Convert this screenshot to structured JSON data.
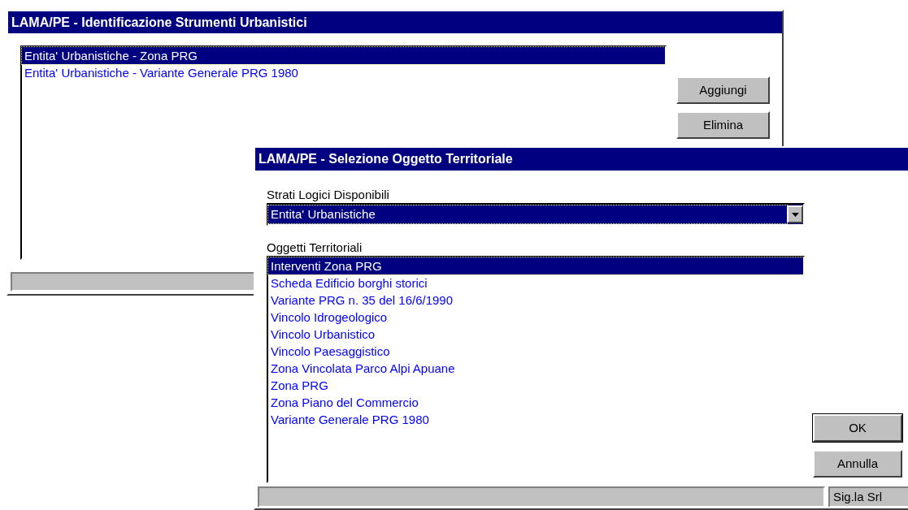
{
  "windows": [
    {
      "title": "LAMA/PE - Identificazione Strumenti Urbanistici",
      "list": [
        {
          "label": "Entita' Urbanistiche - Zona PRG",
          "selected": true
        },
        {
          "label": "Entita' Urbanistiche - Variante Generale PRG 1980",
          "selected": false
        }
      ],
      "buttons": [
        "Aggiungi",
        "Elimina"
      ]
    },
    {
      "title": "LAMA/PE - Selezione Oggetto Territoriale",
      "combo_label": "Strati Logici Disponibili",
      "combo_value": "Entita' Urbanistiche",
      "list_label": "Oggetti Territoriali",
      "list": [
        {
          "label": "Interventi Zona PRG",
          "selected": true
        },
        {
          "label": "Scheda Edificio borghi storici",
          "selected": false
        },
        {
          "label": "Variante PRG n. 35 del 16/6/1990",
          "selected": false
        },
        {
          "label": "Vincolo Idrogeologico",
          "selected": false
        },
        {
          "label": "Vincolo Urbanistico",
          "selected": false
        },
        {
          "label": "Vincolo Paesaggistico",
          "selected": false
        },
        {
          "label": "Zona Vincolata Parco Alpi Apuane",
          "selected": false
        },
        {
          "label": "Zona PRG",
          "selected": false
        },
        {
          "label": "Zona Piano del Commercio",
          "selected": false
        },
        {
          "label": "Variante Generale PRG 1980",
          "selected": false
        }
      ],
      "buttons": [
        "OK",
        "Annulla"
      ],
      "status": "Sig.la Srl"
    }
  ]
}
